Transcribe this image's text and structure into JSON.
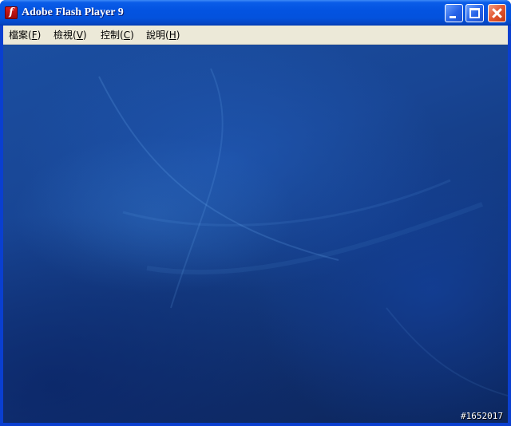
{
  "window": {
    "title": "Adobe Flash Player 9",
    "icon": "flash-player-icon",
    "controls": {
      "minimize": "minimize-icon",
      "maximize": "maximize-icon",
      "close": "close-icon"
    }
  },
  "menubar": {
    "items": [
      {
        "label": "檔案(",
        "key": "F",
        "tail": ")"
      },
      {
        "label": "檢視(",
        "key": "V",
        "tail": ")"
      },
      {
        "label": "控制(",
        "key": "C",
        "tail": ")"
      },
      {
        "label": "說明(",
        "key": "H",
        "tail": ")"
      }
    ]
  },
  "stage": {
    "watermark": "#1652017"
  },
  "colors": {
    "titlebar": "#0352dd",
    "menubar": "#ece9d8",
    "stage": "#184594"
  }
}
